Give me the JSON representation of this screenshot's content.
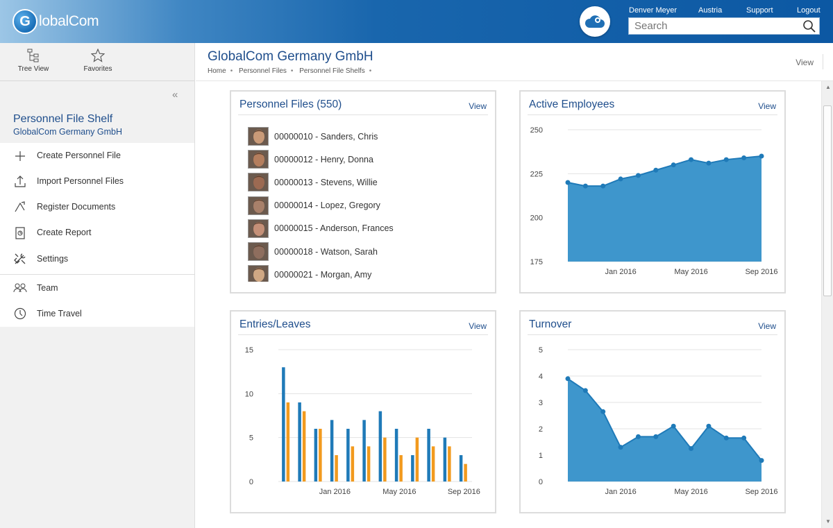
{
  "app": {
    "logo_text_1": "G",
    "logo_text_2": "lobalCom"
  },
  "topbar": {
    "user": "Denver Meyer",
    "country": "Austria",
    "support": "Support",
    "logout": "Logout",
    "search_placeholder": "Search"
  },
  "left": {
    "tree_view": "Tree View",
    "favorites": "Favorites",
    "collapse_icon": "double-chevron-left-icon",
    "shelf_title": "Personnel File Shelf",
    "shelf_subtitle": "GlobalCom Germany GmbH",
    "menu": [
      {
        "label": "Create Personnel File",
        "icon": "plus-icon"
      },
      {
        "label": "Import Personnel Files",
        "icon": "upload-icon"
      },
      {
        "label": "Register Documents",
        "icon": "register-icon"
      },
      {
        "label": "Create Report",
        "icon": "report-icon"
      },
      {
        "label": "Settings",
        "icon": "tools-icon"
      },
      {
        "label": "Team",
        "icon": "team-icon"
      },
      {
        "label": "Time Travel",
        "icon": "clock-icon"
      }
    ]
  },
  "header": {
    "title": "GlobalCom Germany GmbH",
    "breadcrumb": [
      "Home",
      "Personnel Files",
      "Personnel File Shelfs"
    ],
    "view": "View"
  },
  "cards": {
    "personnel": {
      "title": "Personnel Files (550)",
      "view": "View",
      "items": [
        "00000010 - Sanders, Chris",
        "00000012 - Henry, Donna",
        "00000013 - Stevens, Willie",
        "00000014 - Lopez, Gregory",
        "00000015 - Anderson, Frances",
        "00000018 - Watson, Sarah",
        "00000021 - Morgan, Amy"
      ]
    },
    "active": {
      "title": "Active Employees",
      "view": "View"
    },
    "entries": {
      "title": "Entries/Leaves",
      "view": "View"
    },
    "turnover": {
      "title": "Turnover",
      "view": "View"
    }
  },
  "colors": {
    "blue": "#1f7ab8",
    "fill": "#3e96cc",
    "orange": "#f29a1e",
    "title": "#1f4e8c"
  },
  "chart_data": [
    {
      "type": "area",
      "title": "Active Employees",
      "x": [
        "Oct 2015",
        "Nov 2015",
        "Dec 2015",
        "Jan 2016",
        "Feb 2016",
        "Mar 2016",
        "Apr 2016",
        "May 2016",
        "Jun 2016",
        "Jul 2016",
        "Aug 2016",
        "Sep 2016"
      ],
      "values": [
        220,
        218,
        218,
        222,
        224,
        227,
        230,
        233,
        231,
        233,
        234,
        235
      ],
      "ylim": [
        175,
        250
      ],
      "yticks": [
        175,
        200,
        225,
        250
      ],
      "xtick_labels": [
        {
          "label": "Jan 2016",
          "index": 3
        },
        {
          "label": "May 2016",
          "index": 7
        },
        {
          "label": "Sep 2016",
          "index": 11
        }
      ],
      "grid": true
    },
    {
      "type": "bar",
      "title": "Entries/Leaves",
      "categories": [
        "Oct 2015",
        "Nov 2015",
        "Dec 2015",
        "Jan 2016",
        "Feb 2016",
        "Mar 2016",
        "Apr 2016",
        "May 2016",
        "Jun 2016",
        "Jul 2016",
        "Aug 2016",
        "Sep 2016"
      ],
      "series": [
        {
          "values": [
            13,
            9,
            6,
            7,
            6,
            7,
            8,
            6,
            3,
            6,
            5,
            3
          ],
          "color": "#1f7ab8"
        },
        {
          "values": [
            9,
            8,
            6,
            3,
            4,
            4,
            5,
            3,
            5,
            4,
            4,
            2
          ],
          "color": "#f29a1e"
        }
      ],
      "ylim": [
        0,
        15
      ],
      "yticks": [
        0,
        5,
        10,
        15
      ],
      "xtick_labels": [
        {
          "label": "Jan 2016",
          "index": 3
        },
        {
          "label": "May 2016",
          "index": 7
        },
        {
          "label": "Sep 2016",
          "index": 11
        }
      ],
      "grid": true
    },
    {
      "type": "area",
      "title": "Turnover",
      "x": [
        "Oct 2015",
        "Nov 2015",
        "Dec 2015",
        "Jan 2016",
        "Feb 2016",
        "Mar 2016",
        "Apr 2016",
        "May 2016",
        "Jun 2016",
        "Jul 2016",
        "Aug 2016",
        "Sep 2016"
      ],
      "values": [
        3.9,
        3.45,
        2.65,
        1.3,
        1.7,
        1.7,
        2.1,
        1.25,
        2.1,
        1.65,
        1.65,
        0.8
      ],
      "ylim": [
        0,
        5
      ],
      "yticks": [
        0,
        1,
        2,
        3,
        4,
        5
      ],
      "xtick_labels": [
        {
          "label": "Jan 2016",
          "index": 3
        },
        {
          "label": "May 2016",
          "index": 7
        },
        {
          "label": "Sep 2016",
          "index": 11
        }
      ],
      "grid": true
    }
  ]
}
